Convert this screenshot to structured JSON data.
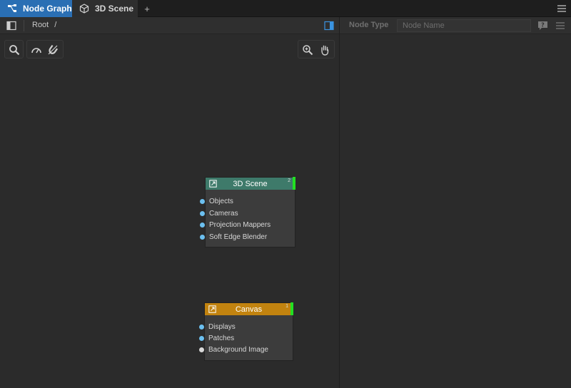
{
  "tabs": [
    {
      "label": "Node Graph",
      "icon": "node-graph-icon",
      "active": true
    },
    {
      "label": "3D Scene",
      "icon": "cube-icon",
      "active": false
    }
  ],
  "tab_add_label": "+",
  "breadcrumb": [
    "Root",
    "/"
  ],
  "right_panel": {
    "node_type_label": "Node Type",
    "node_name_placeholder": "Node Name"
  },
  "nodes": [
    {
      "title": "3D Scene",
      "header_color": "#3e7a6a",
      "marker": "2",
      "ports": [
        "Objects",
        "Cameras",
        "Projection Mappers",
        "Soft Edge Blender"
      ]
    },
    {
      "title": "Canvas",
      "header_color": "#c2830f",
      "marker": "1",
      "ports": [
        "Displays",
        "Patches",
        "Background Image"
      ]
    }
  ],
  "colors": {
    "accent": "#2a6fb4",
    "status_ok": "#22e022",
    "port_blue": "#6cc0f0"
  }
}
